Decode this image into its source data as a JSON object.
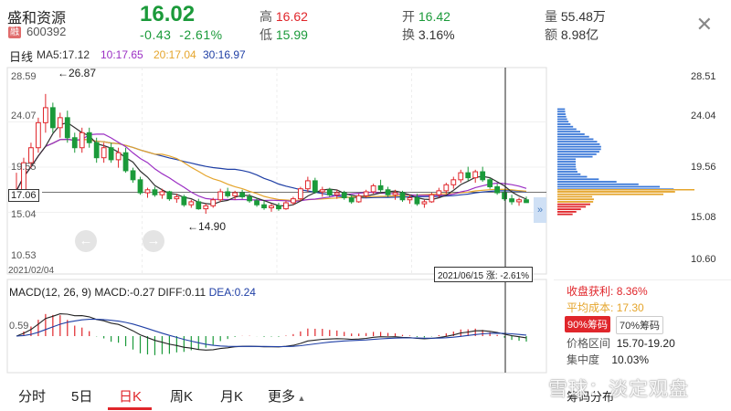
{
  "header": {
    "name": "盛和资源",
    "badge": "融",
    "code": "600392",
    "price": "16.02",
    "change": "-0.43",
    "change_pct": "-2.61%",
    "high_label": "高",
    "high": "16.62",
    "low_label": "低",
    "low": "15.99",
    "open_label": "开",
    "open": "16.42",
    "turnover_label": "换",
    "turnover": "3.16%",
    "volume_label": "量",
    "volume": "55.48万",
    "amount_label": "额",
    "amount": "8.98亿",
    "close_icon": "close-icon"
  },
  "timeframe": "日线",
  "ma": {
    "ma5": "MA5:17.12",
    "ma10": "10:17.65",
    "ma20": "20:17.04",
    "ma30": "30:16.97",
    "colors": {
      "ma5": "#333333",
      "ma10": "#9b2fc4",
      "ma20": "#e5a52c",
      "ma30": "#1f3fa5"
    }
  },
  "axis": {
    "left_ticks": [
      "28.59",
      "24.07",
      "19.55",
      "15.04",
      "10.53"
    ],
    "right_ticks": [
      "28.51",
      "24.04",
      "19.56",
      "15.08",
      "10.60"
    ],
    "current_price_tag": "17.06",
    "start_date": "2021/02/04",
    "crosshair_label": "2021/06/15 涨: -2.61%",
    "high_mark": "←26.87",
    "low_mark": "←14.90"
  },
  "macd": {
    "title": "MACD(12, 26, 9)",
    "macd": "MACD:-0.27",
    "diff": "DIFF:0.11",
    "dea": "DEA:0.24",
    "tick": "0.59"
  },
  "tabs": [
    {
      "label": "分时",
      "active": false
    },
    {
      "label": "5日",
      "active": false
    },
    {
      "label": "日K",
      "active": true
    },
    {
      "label": "周K",
      "active": false
    },
    {
      "label": "月K",
      "active": false
    },
    {
      "label": "更多",
      "active": false
    }
  ],
  "chip_panel": {
    "profit_label": "收盘获利:",
    "profit": "8.36%",
    "cost_label": "平均成本:",
    "cost": "17.30",
    "chip90": "90%筹码",
    "chip70": "70%筹码",
    "range_label": "价格区间",
    "range": "15.70-19.20",
    "conc_label": "集中度",
    "conc": "10.03%",
    "footer": "筹码分布"
  },
  "watermark": "雪球：淡定观盘",
  "chart_data": {
    "type": "candlestick",
    "candles": [
      [
        17.0,
        19.0,
        16.5,
        17.2
      ],
      [
        17.2,
        20.5,
        17.0,
        20.0
      ],
      [
        20.0,
        22.0,
        19.5,
        21.5
      ],
      [
        21.5,
        24.5,
        21.0,
        24.0
      ],
      [
        24.0,
        26.87,
        23.0,
        25.5
      ],
      [
        25.5,
        26.0,
        23.0,
        23.5
      ],
      [
        23.5,
        25.0,
        22.5,
        24.5
      ],
      [
        24.5,
        25.2,
        22.0,
        22.5
      ],
      [
        22.5,
        23.0,
        21.0,
        21.5
      ],
      [
        21.5,
        23.5,
        21.0,
        23.0
      ],
      [
        23.0,
        23.5,
        21.5,
        22.0
      ],
      [
        22.0,
        22.5,
        20.0,
        20.5
      ],
      [
        20.5,
        22.0,
        20.0,
        21.5
      ],
      [
        21.5,
        22.0,
        20.0,
        20.3
      ],
      [
        20.3,
        21.5,
        19.5,
        21.0
      ],
      [
        21.0,
        21.5,
        19.0,
        19.2
      ],
      [
        19.2,
        19.5,
        18.0,
        18.3
      ],
      [
        18.3,
        18.6,
        16.8,
        17.0
      ],
      [
        17.0,
        17.5,
        16.5,
        17.3
      ],
      [
        17.3,
        17.6,
        16.6,
        16.8
      ],
      [
        16.8,
        17.4,
        16.4,
        17.1
      ],
      [
        17.1,
        17.2,
        16.2,
        16.4
      ],
      [
        16.4,
        16.9,
        16.0,
        16.6
      ],
      [
        16.6,
        16.8,
        15.6,
        15.8
      ],
      [
        15.8,
        16.3,
        15.5,
        16.1
      ],
      [
        16.1,
        16.4,
        15.3,
        15.4
      ],
      [
        15.4,
        15.9,
        14.9,
        15.7
      ],
      [
        15.7,
        16.5,
        15.5,
        16.3
      ],
      [
        16.3,
        17.4,
        16.1,
        17.1
      ],
      [
        17.1,
        17.5,
        16.5,
        16.7
      ],
      [
        16.7,
        17.2,
        16.3,
        17.0
      ],
      [
        17.0,
        17.3,
        16.4,
        16.6
      ],
      [
        16.6,
        16.9,
        16.0,
        16.2
      ],
      [
        16.2,
        16.5,
        15.6,
        15.8
      ],
      [
        15.8,
        16.2,
        15.3,
        15.5
      ],
      [
        15.5,
        15.9,
        15.1,
        15.7
      ],
      [
        15.7,
        16.0,
        15.2,
        15.4
      ],
      [
        15.4,
        16.2,
        15.3,
        16.0
      ],
      [
        16.0,
        16.6,
        15.8,
        16.4
      ],
      [
        16.4,
        17.6,
        16.2,
        17.4
      ],
      [
        17.4,
        18.6,
        17.1,
        18.2
      ],
      [
        18.2,
        18.5,
        16.9,
        17.1
      ],
      [
        17.1,
        17.6,
        16.6,
        17.3
      ],
      [
        17.3,
        17.5,
        16.6,
        16.8
      ],
      [
        16.8,
        17.3,
        16.4,
        17.0
      ],
      [
        17.0,
        17.2,
        16.3,
        16.5
      ],
      [
        16.5,
        16.8,
        15.9,
        16.1
      ],
      [
        16.1,
        16.9,
        16.0,
        16.7
      ],
      [
        16.7,
        17.3,
        16.5,
        17.1
      ],
      [
        17.1,
        17.9,
        16.9,
        17.7
      ],
      [
        17.7,
        18.3,
        17.1,
        17.3
      ],
      [
        17.3,
        17.6,
        16.6,
        16.8
      ],
      [
        16.8,
        17.3,
        16.3,
        17.0
      ],
      [
        17.0,
        17.2,
        16.1,
        16.3
      ],
      [
        16.3,
        16.8,
        15.9,
        16.5
      ],
      [
        16.5,
        16.9,
        15.7,
        15.9
      ],
      [
        15.9,
        16.3,
        15.5,
        16.1
      ],
      [
        16.1,
        17.0,
        16.0,
        16.8
      ],
      [
        16.8,
        17.5,
        16.5,
        17.2
      ],
      [
        17.2,
        18.0,
        16.9,
        17.8
      ],
      [
        17.8,
        18.6,
        17.4,
        18.3
      ],
      [
        18.3,
        19.3,
        18.0,
        19.0
      ],
      [
        19.0,
        19.6,
        18.2,
        18.5
      ],
      [
        18.5,
        19.3,
        18.0,
        19.1
      ],
      [
        19.1,
        19.6,
        18.1,
        18.3
      ],
      [
        18.3,
        18.5,
        17.4,
        17.6
      ],
      [
        17.6,
        17.9,
        16.8,
        17.0
      ],
      [
        17.0,
        17.3,
        16.2,
        16.4
      ],
      [
        16.4,
        16.8,
        15.8,
        16.1
      ],
      [
        16.1,
        16.5,
        15.7,
        16.3
      ],
      [
        16.3,
        16.62,
        15.99,
        16.02
      ]
    ],
    "xlabels": [
      "2021/02/04",
      "2021/06/15"
    ],
    "ylim": [
      10.53,
      28.59
    ]
  }
}
